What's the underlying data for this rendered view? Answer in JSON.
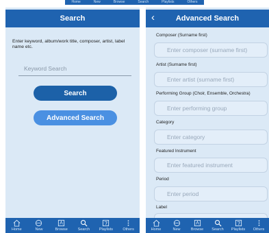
{
  "top_strip": {
    "labels": [
      "Home",
      "New",
      "Browse",
      "Search",
      "Playlists",
      "Others"
    ]
  },
  "search_screen": {
    "title": "Search",
    "hint": "Enter keyword, album/work title, composer, artist, label name etc.",
    "keyword_placeholder": "Keyword Search",
    "search_button": "Search",
    "advanced_button": "Advanced Search"
  },
  "advanced_screen": {
    "back_icon": "chevron-left-icon",
    "title": "Advanced Search",
    "fields": [
      {
        "label": "Composer (Surname first)",
        "placeholder": "Enter composer (surname first)"
      },
      {
        "label": "Artist (Surname first)",
        "placeholder": "Enter artist (surname first)"
      },
      {
        "label": "Performing Group (Choir, Ensemble, Orchestra)",
        "placeholder": "Enter performing group"
      },
      {
        "label": "Category",
        "placeholder": "Enter category"
      },
      {
        "label": "Featured Instrument",
        "placeholder": "Enter featured instrument"
      },
      {
        "label": "Period",
        "placeholder": "Enter period"
      },
      {
        "label": "Label",
        "placeholder": ""
      }
    ]
  },
  "tabbar": {
    "tabs": [
      {
        "label": "Home",
        "icon": "home-icon"
      },
      {
        "label": "New",
        "icon": "new-icon"
      },
      {
        "label": "Browse",
        "icon": "browse-icon"
      },
      {
        "label": "Search",
        "icon": "search-icon"
      },
      {
        "label": "Playlists",
        "icon": "playlist-icon"
      },
      {
        "label": "Others",
        "icon": "more-icon"
      }
    ]
  },
  "colors": {
    "header_blue": "#1f63b0",
    "background": "#dbe9f6",
    "button_dark": "#1c61a8",
    "button_light": "#4a90e2"
  }
}
